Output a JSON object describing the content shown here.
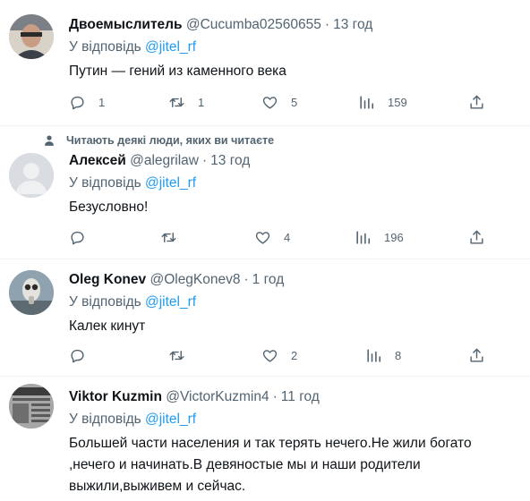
{
  "social_context": "Читають деякі люди, яких ви читаєте",
  "reply_prefix": "У відповідь",
  "tweets": [
    {
      "name": "Двоемыслитель",
      "handle": "@Cucumba02560655",
      "dot": "·",
      "time": "13 год",
      "reply_to": "@jitel_rf",
      "text": "Путин — гений из каменного века",
      "replies": "1",
      "retweets": "1",
      "likes": "5",
      "views": "159"
    },
    {
      "name": "Алексей",
      "handle": "@alegrilaw",
      "dot": "·",
      "time": "13 год",
      "reply_to": "@jitel_rf",
      "text": "Безусловно!",
      "replies": "",
      "retweets": "",
      "likes": "4",
      "views": "196"
    },
    {
      "name": "Oleg Konev",
      "handle": "@OlegKonev8",
      "dot": "·",
      "time": "1 год",
      "reply_to": "@jitel_rf",
      "text": "Калек кинут",
      "replies": "",
      "retweets": "",
      "likes": "2",
      "views": "8"
    },
    {
      "name": "Viktor Kuzmin",
      "handle": "@VictorKuzmin4",
      "dot": "·",
      "time": "11 год",
      "reply_to": "@jitel_rf",
      "text": "Большей части населения и так терять нечего.Не жили богато ,нечего и начинать.В девяностые мы и наши родители выжили,выживем и сейчас."
    }
  ]
}
